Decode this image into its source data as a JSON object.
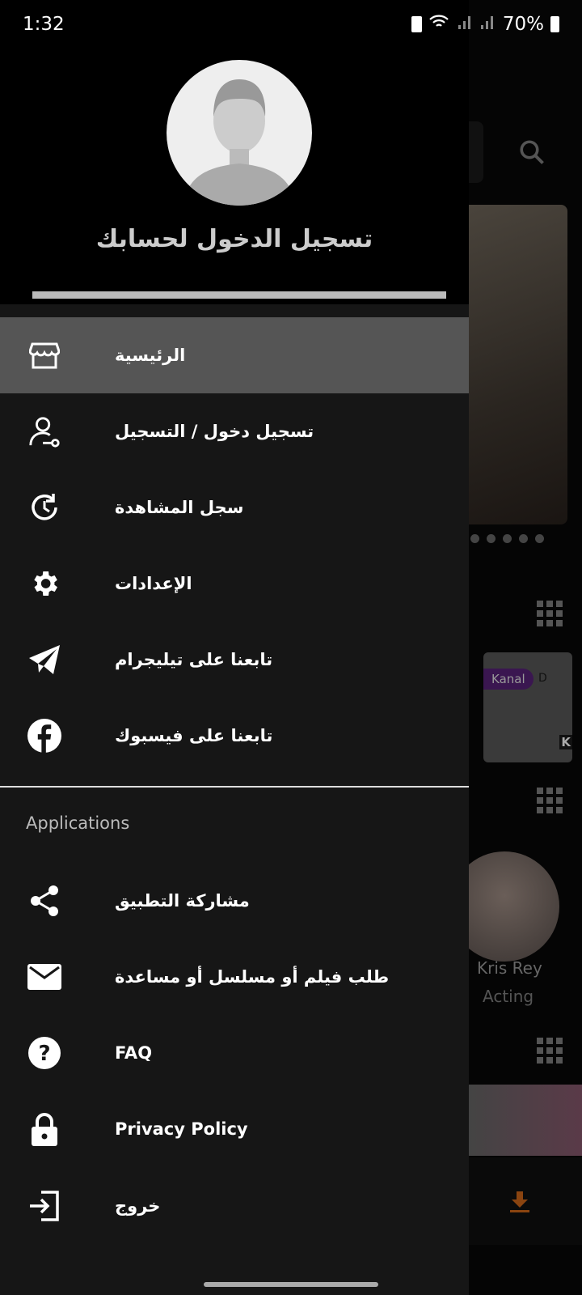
{
  "status": {
    "time": "1:32",
    "battery": "70%"
  },
  "drawer": {
    "header_title": "تسجيل الدخول لحسابك",
    "items": [
      {
        "label": "الرئيسية",
        "icon": "store-icon",
        "active": true
      },
      {
        "label": "تسجيل دخول / التسجيل",
        "icon": "user-key-icon"
      },
      {
        "label": "سجل المشاهدة",
        "icon": "history-icon"
      },
      {
        "label": "الإعدادات",
        "icon": "gear-icon"
      },
      {
        "label": "تابعنا على تيليجرام",
        "icon": "telegram-icon"
      },
      {
        "label": "تابعنا على فيسبوك",
        "icon": "facebook-icon"
      }
    ],
    "section": "Applications",
    "app_items": [
      {
        "label": "مشاركة التطبيق",
        "icon": "share-icon"
      },
      {
        "label": "طلب فيلم أو مسلسل أو مساعدة",
        "icon": "mail-icon"
      },
      {
        "label": "FAQ",
        "icon": "help-icon"
      },
      {
        "label": "Privacy Policy",
        "icon": "lock-icon"
      },
      {
        "label": "خروج",
        "icon": "logout-icon"
      }
    ]
  },
  "background": {
    "badge": "Kanal",
    "badge_suffix": "D",
    "badge_corner": "K",
    "person_name": "Kris Rey",
    "person_role": "Acting",
    "accent": "#e8711a",
    "badge_color": "#5a1f78"
  }
}
